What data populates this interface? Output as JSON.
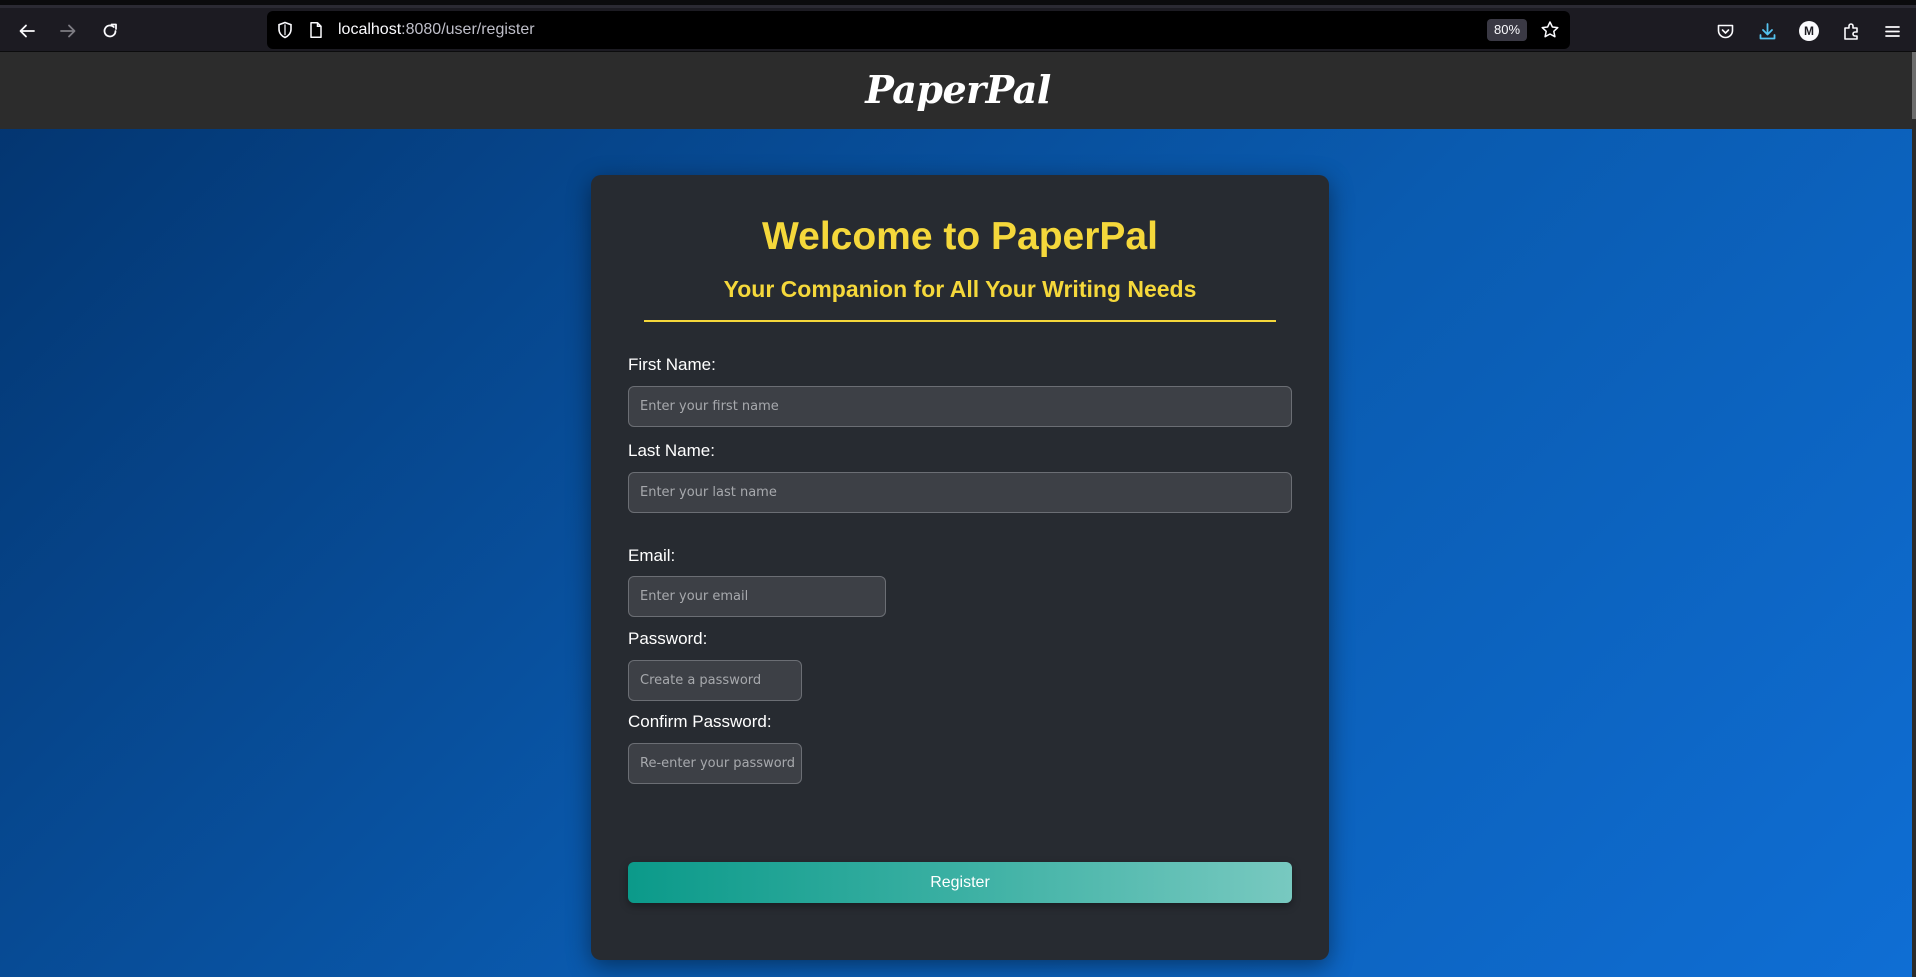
{
  "browser": {
    "url_host": "localhost",
    "url_path": ":8080/user/register",
    "zoom": "80%",
    "avatar_letter": "M",
    "icons": [
      "back-icon",
      "forward-icon",
      "reload-icon",
      "shield-icon",
      "page-icon",
      "star-icon",
      "pocket-icon",
      "download-icon",
      "account-icon",
      "extensions-icon",
      "menu-icon"
    ]
  },
  "site": {
    "brand": "PaperPal"
  },
  "form": {
    "title": "Welcome to PaperPal",
    "subtitle": "Your Companion for All Your Writing Needs",
    "first_name_label": "First Name:",
    "first_name_placeholder": "Enter your first name",
    "last_name_label": "Last Name:",
    "last_name_placeholder": "Enter your last name",
    "email_label": "Email:",
    "email_placeholder": "Enter your email",
    "password_label": "Password:",
    "password_placeholder": "Create a password",
    "confirm_label": "Confirm Password:",
    "confirm_placeholder": "Re-enter your password",
    "register_label": "Register"
  },
  "colors": {
    "accent_yellow": "#f5d83b",
    "card_bg": "#272b31",
    "header_bg": "#2c2c2c",
    "button_teal": "#0b9a8a"
  }
}
